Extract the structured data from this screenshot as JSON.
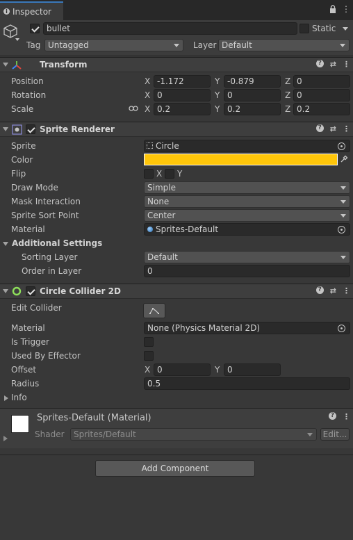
{
  "tab": {
    "title": "Inspector"
  },
  "object": {
    "name": "bullet",
    "static_label": "Static",
    "tag_label": "Tag",
    "tag_value": "Untagged",
    "layer_label": "Layer",
    "layer_value": "Default"
  },
  "transform": {
    "title": "Transform",
    "position_label": "Position",
    "rotation_label": "Rotation",
    "scale_label": "Scale",
    "axis_x": "X",
    "axis_y": "Y",
    "axis_z": "Z",
    "position": {
      "x": "-1.172",
      "y": "-0.879",
      "z": "0"
    },
    "rotation": {
      "x": "0",
      "y": "0",
      "z": "0"
    },
    "scale": {
      "x": "0.2",
      "y": "0.2",
      "z": "0.2"
    }
  },
  "sprite_renderer": {
    "title": "Sprite Renderer",
    "sprite_label": "Sprite",
    "sprite_value": "Circle",
    "color_label": "Color",
    "color_value": "#ffc60a",
    "flip_label": "Flip",
    "flip_x": "X",
    "flip_y": "Y",
    "draw_mode_label": "Draw Mode",
    "draw_mode_value": "Simple",
    "mask_label": "Mask Interaction",
    "mask_value": "None",
    "sort_point_label": "Sprite Sort Point",
    "sort_point_value": "Center",
    "material_label": "Material",
    "material_value": "Sprites-Default",
    "additional_label": "Additional Settings",
    "sorting_layer_label": "Sorting Layer",
    "sorting_layer_value": "Default",
    "order_label": "Order in Layer",
    "order_value": "0"
  },
  "circle_collider": {
    "title": "Circle Collider 2D",
    "edit_label": "Edit Collider",
    "material_label": "Material",
    "material_value": "None (Physics Material 2D)",
    "trigger_label": "Is Trigger",
    "effector_label": "Used By Effector",
    "offset_label": "Offset",
    "offset_x": "0",
    "offset_y": "0",
    "radius_label": "Radius",
    "radius_value": "0.5",
    "info_label": "Info"
  },
  "material_preview": {
    "title": "Sprites-Default (Material)",
    "shader_label": "Shader",
    "shader_value": "Sprites/Default",
    "edit_label": "Edit..."
  },
  "add_component_label": "Add Component",
  "colors": {
    "accent": "#3a79bb",
    "panel": "#383838",
    "header": "#3e3e3e",
    "sprite_color": "#ffc60a"
  }
}
